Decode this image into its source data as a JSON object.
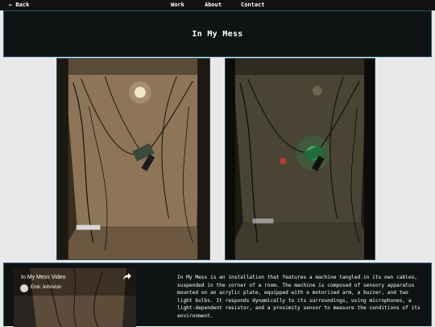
{
  "topbar": {
    "back_label": "← Back",
    "nav": {
      "work": "Work",
      "about": "About",
      "contact": "Contact"
    }
  },
  "header": {
    "title": "In My Mess"
  },
  "video": {
    "title": "In My Mess Video",
    "channel": "Emir Johnston"
  },
  "description": "In My Mess is an installation that features a machine tangled in its own cables, suspended in the corner of a room. The machine is composed of sensory apparatus mounted on an acrylic plate, equipped with a motorized arm, a buzzer, and two light bulbs. It responds dynamically to its surroundings, using microphones, a light-dependent resistor, and a proximity sensor to measure the conditions of its environment.",
  "colors": {
    "page_bg": "#e9e9e9",
    "band_bg": "#101314",
    "band_border": "#2b5c6a",
    "text": "#ffffff"
  }
}
